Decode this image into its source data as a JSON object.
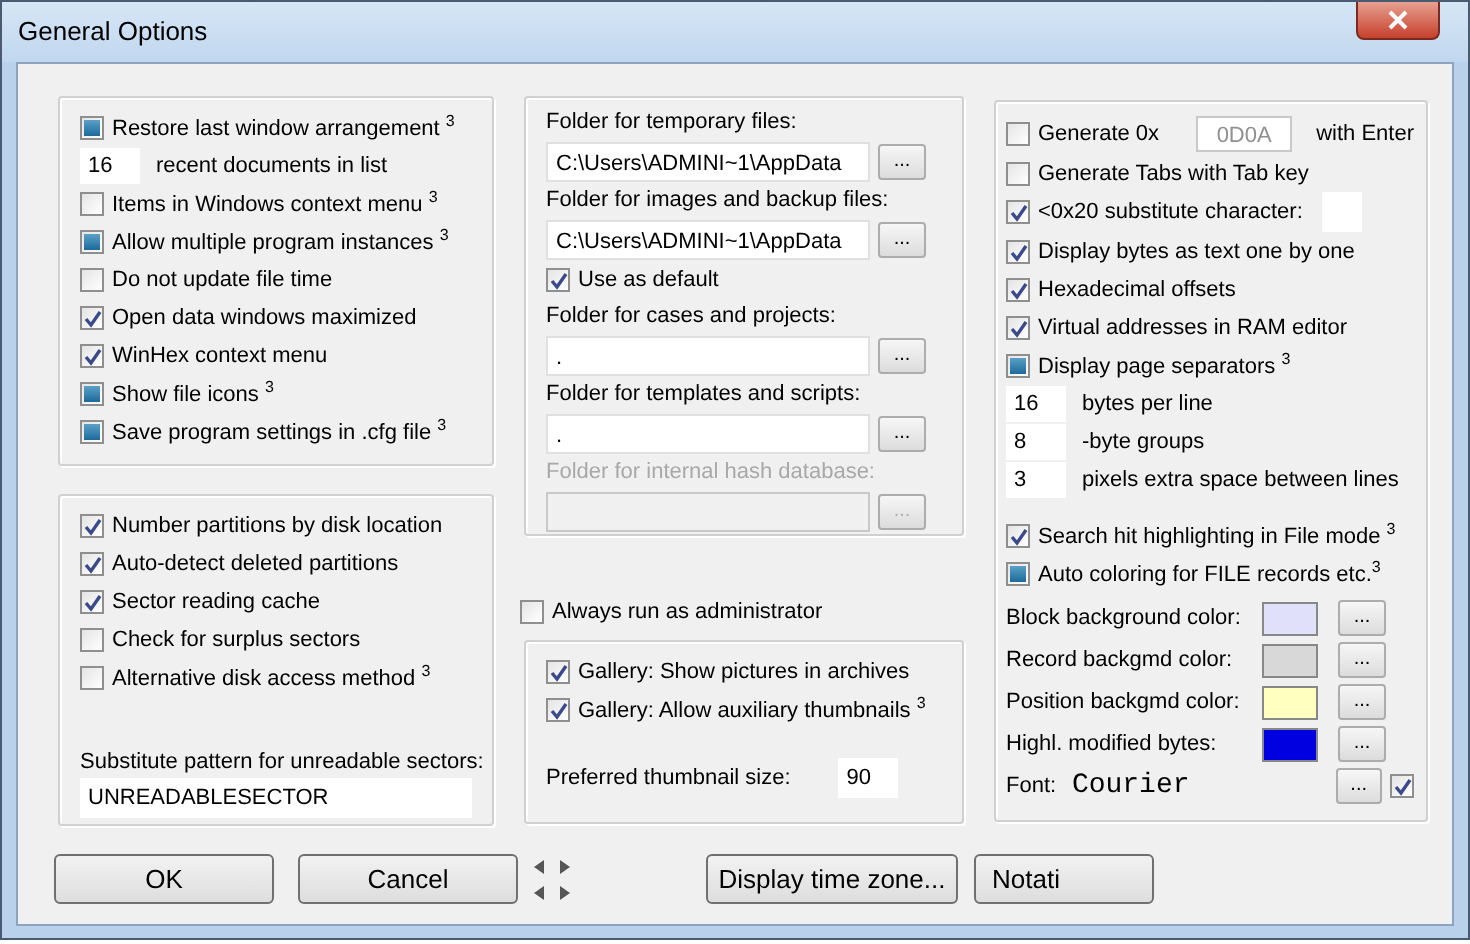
{
  "window": {
    "title": "General Options"
  },
  "general_group": [
    {
      "kind": "checkbox",
      "label": "Restore last window arrangement $^{3}$",
      "checked": false,
      "mixed": true
    },
    {
      "kind": "number",
      "count": "16",
      "label": "recent documents in list"
    },
    {
      "kind": "checkbox",
      "label": "Items in Windows context menu $^{3}$",
      "checked": false,
      "mixed": false
    },
    {
      "kind": "checkbox",
      "label": "Allow multiple program instances $^{3}$",
      "checked": false,
      "mixed": true
    },
    {
      "kind": "checkbox",
      "label": "Do not update file time",
      "checked": false,
      "mixed": false
    },
    {
      "kind": "checkbox",
      "label": "Open data windows maximized",
      "checked": true,
      "mixed": false
    },
    {
      "kind": "checkbox",
      "label": "WinHex context menu",
      "checked": true,
      "mixed": false
    },
    {
      "kind": "checkbox",
      "label": "Show file icons $^{3}$",
      "checked": false,
      "mixed": true
    },
    {
      "kind": "checkbox",
      "label": "Save program settings in .cfg file $^{3}$",
      "checked": false,
      "mixed": true
    }
  ],
  "disk_group": {
    "items": [
      {
        "label": "Number partitions by disk location",
        "checked": true,
        "mixed": false
      },
      {
        "label": "Auto-detect deleted partitions",
        "checked": true,
        "mixed": false
      },
      {
        "label": "Sector reading cache",
        "checked": true,
        "mixed": false
      },
      {
        "label": "Check for surplus sectors",
        "checked": false,
        "mixed": false
      },
      {
        "label": "Alternative disk access method $^{3}$",
        "checked": false,
        "mixed": false
      }
    ],
    "pattern_label": "Substitute pattern for unreadable sectors:",
    "pattern_value": "UNREADABLESECTOR"
  },
  "folder_group": [
    {
      "kind": "folder",
      "label": "Folder for temporary files:",
      "value": "C:\\Users\\ADMINI~1\\AppData",
      "button": "...",
      "disabled": false
    },
    {
      "kind": "folder",
      "label": "Folder for images and backup files:",
      "value": "C:\\Users\\ADMINI~1\\AppData",
      "button": "...",
      "disabled": false
    },
    {
      "kind": "checkbox",
      "label": "Use as default",
      "checked": true,
      "mixed": false
    },
    {
      "kind": "folder",
      "label": "Folder for cases and projects:",
      "value": ".",
      "button": "...",
      "disabled": false
    },
    {
      "kind": "folder",
      "label": "Folder for templates and scripts:",
      "value": ".",
      "button": "...",
      "disabled": false
    },
    {
      "kind": "folder",
      "label": "Folder for internal hash database:",
      "button": "...",
      "disabled": true
    }
  ],
  "run_as_admin": {
    "label": "Always run as administrator",
    "checked": false,
    "mixed": false
  },
  "gallery_group": {
    "items": [
      {
        "label": "Gallery: Show pictures in archives",
        "checked": true,
        "mixed": false
      },
      {
        "label": "Gallery: Allow auxiliary thumbnails $^{3}$",
        "checked": true,
        "mixed": false
      }
    ],
    "size_label": "Preferred thumbnail size:",
    "size_value": "90"
  },
  "editor_group": [
    {
      "kind": "hex",
      "label": "Generate 0x",
      "value": "0D0A",
      "suffix": "with Enter",
      "checked": false,
      "mixed": false
    },
    {
      "kind": "checkbox",
      "label": "Generate Tabs with Tab key",
      "checked": false,
      "mixed": false
    },
    {
      "kind": "char",
      "label": "<0x20 substitute character:",
      "checked": true,
      "mixed": false
    },
    {
      "kind": "checkbox",
      "label": "Display bytes as text one by one",
      "checked": true,
      "mixed": false
    },
    {
      "kind": "checkbox",
      "label": "Hexadecimal offsets",
      "checked": true,
      "mixed": false
    },
    {
      "kind": "checkbox",
      "label": "Virtual addresses in RAM editor",
      "checked": true,
      "mixed": false
    },
    {
      "kind": "checkbox",
      "label": "Display page separators $^{3}$",
      "checked": false,
      "mixed": true
    },
    {
      "kind": "number",
      "count": "16",
      "label": "bytes per line"
    },
    {
      "kind": "number",
      "count": "8",
      "label": "-byte groups"
    },
    {
      "kind": "number",
      "count": "3",
      "label": "pixels extra space between lines"
    },
    {
      "kind": "checkbox",
      "label": "Search hit highlighting in File mode $^{3}$",
      "checked": true,
      "mixed": false
    },
    {
      "kind": "checkbox",
      "label": "Auto coloring for FILE records etc.$^{3}$",
      "checked": false,
      "mixed": true
    }
  ],
  "colors": [
    {
      "label": "Block background color:",
      "color": "#e0e0fa",
      "button": "..."
    },
    {
      "label": "Record backgmd color:",
      "color": "#d8d8d8",
      "button": "..."
    },
    {
      "label": "Position backgmd color:",
      "color": "#ffffc0",
      "button": "..."
    },
    {
      "label": "Highl. modified bytes:",
      "color": "#0000e0",
      "button": "..."
    }
  ],
  "font": {
    "label": "Font:",
    "value": "Courier",
    "button": "...",
    "checked": true,
    "mixed": false
  },
  "buttons": [
    {
      "kind": "push",
      "label": "OK"
    },
    {
      "kind": "push",
      "label": "Cancel"
    },
    {
      "kind": "spin"
    },
    {
      "kind": "push",
      "label": "Display time zone..."
    },
    {
      "kind": "push",
      "label": "Notati"
    }
  ]
}
